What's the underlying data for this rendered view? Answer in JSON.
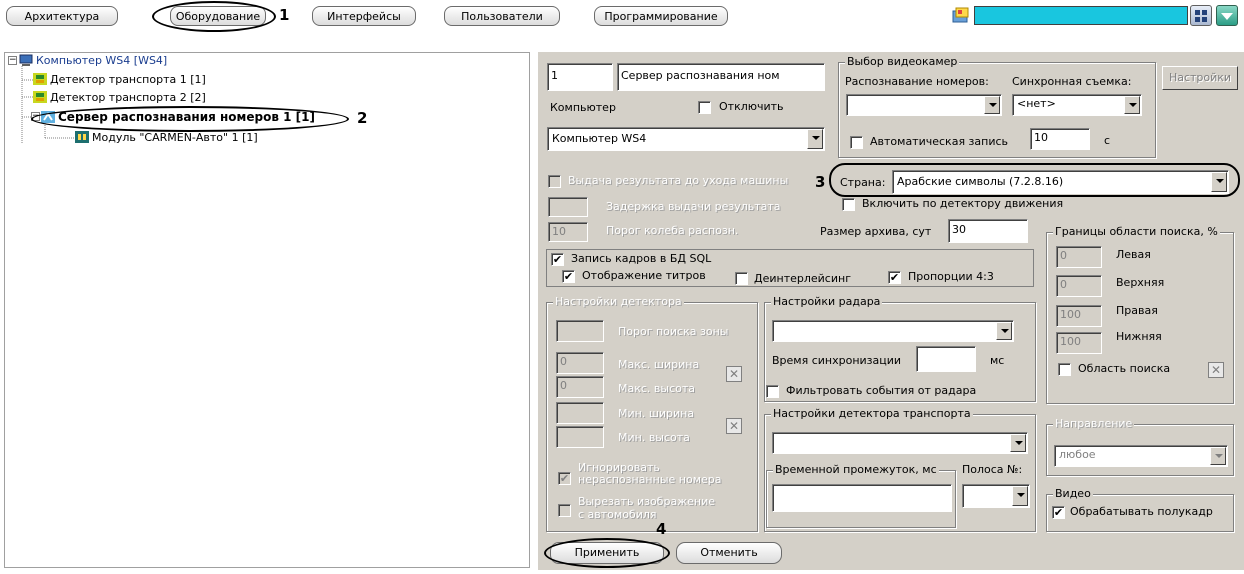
{
  "toolbar": {
    "tabs": [
      "Архитектура",
      "Оборудование",
      "Интерфейсы",
      "Пользователи",
      "Программирование"
    ]
  },
  "callouts": {
    "c1": "1",
    "c2": "2",
    "c3": "3",
    "c4": "4"
  },
  "tree": {
    "computer": "Компьютер WS4 [WS4]",
    "detector1": "Детектор транспорта 1 [1]",
    "detector2": "Детектор транспорта 2 [2]",
    "server": "Сервер распознавания номеров 1 [1]",
    "module": "Модуль \"CARMEN-Авто\" 1 [1]"
  },
  "form": {
    "id_value": "1",
    "name_value": "Сервер распознавания ном",
    "computer_label": "Компьютер",
    "disable_label": "Отключить",
    "computer_value": "Компьютер WS4",
    "cam_group": "Выбор видеокамер",
    "recog_label": "Распознавание номеров:",
    "sync_label": "Синхронная съемка:",
    "sync_value": "<нет>",
    "settings_button": "Настройки",
    "autorec_label": "Автоматическая запись",
    "autorec_value": "10",
    "autorec_unit": "с",
    "result_before_exit": "Выдача результата до ухода машины",
    "result_delay": "Задержка выдачи результата",
    "recog_threshold": "Порог колеба распозн.",
    "result_delay_value": "",
    "threshold_value": "10",
    "country_label": "Страна:",
    "country_value": "Арабские символы (7.2.8.16)",
    "motion_label": "Включить по детектору движения",
    "archive_label": "Размер архива, сут",
    "archive_value": "30",
    "sql_label": "Запись кадров в БД SQL",
    "titles_label": "Отображение титров",
    "deinterlace_label": "Деинтерлейсинг",
    "aspect_label": "Пропорции 4:3",
    "bounds_group": "Границы области поиска, %",
    "left_label": "Левая",
    "top_label": "Верхняя",
    "right_label": "Правая",
    "bottom_label": "Нижняя",
    "left_value": "0",
    "top_value": "0",
    "right_value": "100",
    "bottom_value": "100",
    "search_area_label": "Область поиска",
    "det_group": "Настройки детектора",
    "zone_threshold": "Порог поиска зоны",
    "max_width": "Макс. ширина",
    "max_height": "Макс. высота",
    "min_width": "Мин. ширина",
    "min_height": "Мин. высота",
    "max_width_value": "0",
    "max_height_value": "0",
    "ignore_label_1": "Игнорировать",
    "ignore_label_2": "нераспознанные номера",
    "cut_label_1": "Вырезать изображение",
    "cut_label_2": "с автомобиля",
    "radar_group": "Настройки радара",
    "sync_time_label": "Время синхронизации",
    "ms_label": "мс",
    "filter_label": "Фильтровать события от радара",
    "vd_group": "Настройки детектора транспорта",
    "interval_label": "Временной промежуток, мс",
    "lane_label": "Полоса №:",
    "dir_group": "Направление",
    "dir_value": "любое",
    "video_group": "Видео",
    "halfframe_label": "Обрабатывать полукадр"
  },
  "buttons": {
    "apply": "Применить",
    "cancel": "Отменить"
  },
  "checks": {
    "check": "✔",
    "x": "✕"
  }
}
